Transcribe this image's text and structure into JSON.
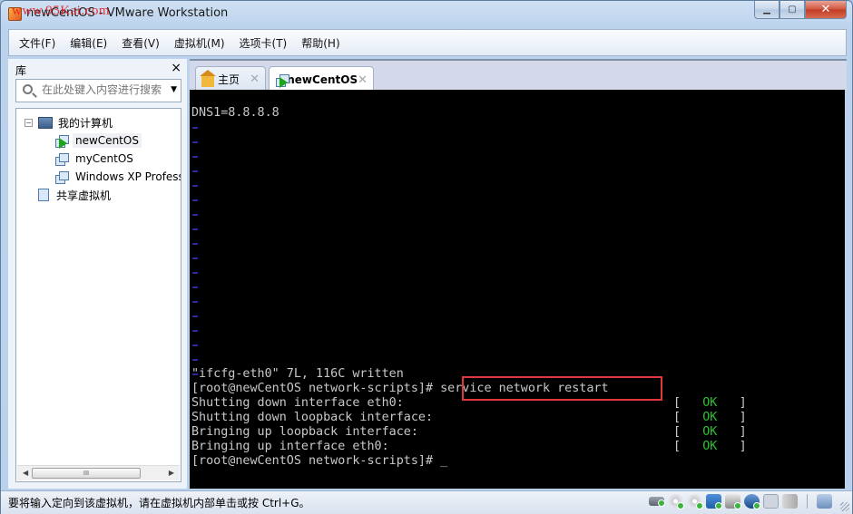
{
  "window": {
    "title": "newCentOS - VMware Workstation",
    "watermark": "www.95Kai.com",
    "controls": {
      "minimize": "minimize",
      "maximize": "maximize",
      "close": "close"
    }
  },
  "menu": {
    "items": [
      {
        "label": "文件(F)"
      },
      {
        "label": "编辑(E)"
      },
      {
        "label": "查看(V)"
      },
      {
        "label": "虚拟机(M)"
      },
      {
        "label": "选项卡(T)"
      },
      {
        "label": "帮助(H)"
      }
    ]
  },
  "library": {
    "title": "库",
    "close_icon": "×",
    "search": {
      "placeholder": "在此处键入内容进行搜索",
      "value": ""
    },
    "tree": {
      "root": {
        "label": "我的计算机",
        "expander": "−"
      },
      "vms": [
        {
          "label": "newCentOS",
          "running": true,
          "selected": true
        },
        {
          "label": "myCentOS",
          "running": false,
          "selected": false
        },
        {
          "label": "Windows XP Profess",
          "running": false,
          "selected": false
        }
      ],
      "shared": {
        "label": "共享虚拟机"
      }
    },
    "scrollbar": {
      "left": "◀",
      "right": "▶",
      "thumb": "III"
    }
  },
  "tabs": [
    {
      "label": "主页",
      "icon": "home-icon",
      "active": false,
      "close": "✕"
    },
    {
      "label": "newCentOS",
      "icon": "vm-running-icon",
      "active": true,
      "close": "✕"
    }
  ],
  "console": {
    "first_line": "DNS1=8.8.8.8",
    "tilde_count": 18,
    "lines": [
      "\"ifcfg-eth0\" 7L, 116C written",
      "[root@newCentOS network-scripts]# service network restart",
      "Shutting down interface eth0:",
      "Shutting down loopback interface:",
      "Bringing up loopback interface:",
      "Bringing up interface eth0:",
      "[root@newCentOS network-scripts]# _"
    ],
    "highlighted_command": "service network restart",
    "status": [
      {
        "open": "[",
        "text": "OK",
        "close": "]"
      },
      {
        "open": "[",
        "text": "OK",
        "close": "]"
      },
      {
        "open": "[",
        "text": "OK",
        "close": "]"
      },
      {
        "open": "[",
        "text": "OK",
        "close": "]"
      }
    ],
    "colors": {
      "ok": "#2fbf2f",
      "highlight": "#e0383a",
      "tilde": "#2b2b9e"
    }
  },
  "statusbar": {
    "message": "要将输入定向到该虚拟机，请在虚拟机内部单击或按 Ctrl+G。",
    "device_icons": [
      "hard-disk-icon",
      "cd-dvd-icon",
      "cd-dvd-icon",
      "network-adapter-icon",
      "printer-icon",
      "sound-card-icon",
      "camera-icon",
      "removable-device-icon",
      "message-log-icon"
    ]
  }
}
